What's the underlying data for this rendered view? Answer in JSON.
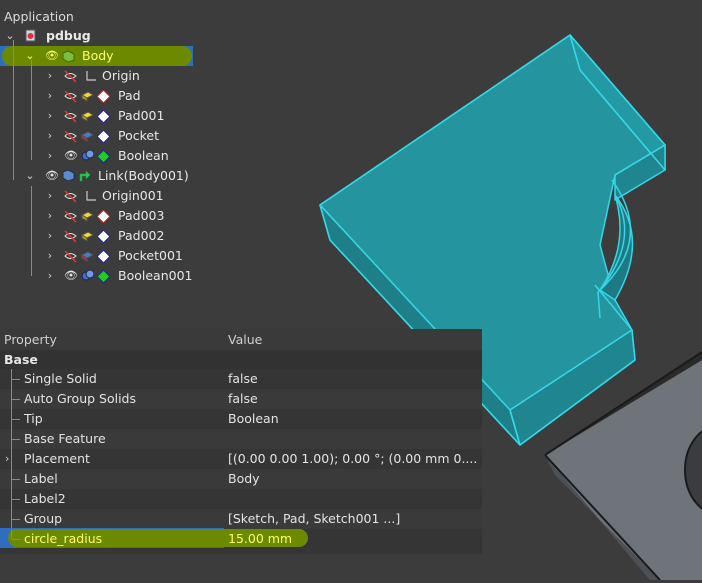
{
  "tree": {
    "header": "Application",
    "document": "pdbug",
    "items": [
      {
        "label": "Body"
      },
      {
        "label": "Origin"
      },
      {
        "label": "Pad"
      },
      {
        "label": "Pad001"
      },
      {
        "label": "Pocket"
      },
      {
        "label": "Boolean"
      },
      {
        "label": "Link(Body001)"
      },
      {
        "label": "Origin001"
      },
      {
        "label": "Pad003"
      },
      {
        "label": "Pad002"
      },
      {
        "label": "Pocket001"
      },
      {
        "label": "Boolean001"
      }
    ]
  },
  "properties": {
    "col_property": "Property",
    "col_value": "Value",
    "group": "Base",
    "rows": [
      {
        "key": "Single Solid",
        "value": "false"
      },
      {
        "key": "Auto Group Solids",
        "value": "false"
      },
      {
        "key": "Tip",
        "value": "Boolean"
      },
      {
        "key": "Base Feature",
        "value": ""
      },
      {
        "key": "Placement",
        "value": "[(0.00 0.00 1.00); 0.00 °; (0.00 mm  0...."
      },
      {
        "key": "Label",
        "value": "Body"
      },
      {
        "key": "Label2",
        "value": ""
      },
      {
        "key": "Group",
        "value": "[Sketch, Pad, Sketch001 ...]"
      },
      {
        "key": "circle_radius",
        "value": "15.00 mm"
      }
    ]
  },
  "colors": {
    "background": "#3c3c3c",
    "selection": "#2f6dbf",
    "highlight_mark": "#6b8a00",
    "selected_text": "#ffff66",
    "model_face": "#2aa6b3",
    "model_edge": "#35d6e6",
    "block_face": "#6e737a"
  },
  "icons": [
    "collapse-chevron-icon",
    "document-icon",
    "eye-icon",
    "hidden-eye-icon",
    "body-icon",
    "pad-icon",
    "pocket-icon",
    "boolean-icon",
    "link-icon",
    "origin-icon",
    "expand-chevron-icon"
  ]
}
